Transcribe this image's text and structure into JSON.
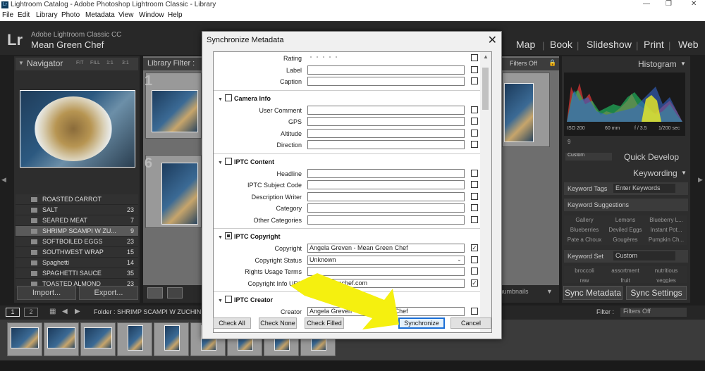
{
  "titlebar": {
    "app_icon": "Lr",
    "title": "Lightroom Catalog - Adobe Photoshop Lightroom Classic - Library",
    "minimize": "—",
    "maximize": "❐",
    "close": "✕"
  },
  "menu": [
    "File",
    "Edit",
    "Library",
    "Photo",
    "Metadata",
    "View",
    "Window",
    "Help"
  ],
  "identity": {
    "logo": "Lr",
    "app_name": "Adobe Lightroom Classic CC",
    "catalog_name": "Mean Green Chef"
  },
  "modules": [
    "Map",
    "Book",
    "Slideshow",
    "Print",
    "Web"
  ],
  "navigator": {
    "title": "Navigator",
    "zoom": [
      "FIT",
      "FILL",
      "1:1",
      "3:1"
    ]
  },
  "folders": [
    {
      "name": "ROASTED CARROT",
      "count": ""
    },
    {
      "name": "SALT",
      "count": "23"
    },
    {
      "name": "SEARED MEAT",
      "count": "7"
    },
    {
      "name": "SHRIMP SCAMPI W ZU...",
      "count": "9",
      "selected": true
    },
    {
      "name": "SOFTBOILED EGGS",
      "count": "23"
    },
    {
      "name": "SOUTHWEST WRAP",
      "count": "15"
    },
    {
      "name": "Spaghetti",
      "count": "14"
    },
    {
      "name": "SPAGHETTI SAUCE",
      "count": "35"
    },
    {
      "name": "TOASTED ALMOND",
      "count": "23"
    }
  ],
  "left_buttons": {
    "import": "Import...",
    "export": "Export..."
  },
  "library_filter": {
    "label": "Library Filter :",
    "filters_off": "Filters Off"
  },
  "grid_numbers": [
    "1",
    "6"
  ],
  "toolbar": {
    "thumbnails": "Thumbnails"
  },
  "histogram": {
    "title": "Histogram",
    "iso": "ISO 200",
    "focal": "60 mm",
    "aperture": "f / 3.5",
    "shutter": "1/200 sec",
    "count": "9"
  },
  "quick_develop": {
    "preset": "Custom",
    "title": "Quick Develop"
  },
  "keywording": {
    "title": "Keywording",
    "tags_label": "Keyword Tags",
    "tags_value": "Enter Keywords",
    "suggestions_title": "Keyword Suggestions",
    "suggestions": [
      "Gallery",
      "Lemons",
      "Blueberry L...",
      "Blueberries",
      "Deviled Eggs",
      "Instant Pot...",
      "Pate a Choux",
      "Gougères",
      "Pumpkin Ch..."
    ],
    "set_label": "Keyword Set",
    "set_value": "Custom",
    "set_items": [
      "broccoli",
      "assortment",
      "nutritious",
      "raw",
      "fruit",
      "veggies"
    ]
  },
  "right_buttons": {
    "sync_metadata": "Sync Metadata",
    "sync_settings": "Sync Settings"
  },
  "filmbar": {
    "page1": "1",
    "page2": "2",
    "folder_label": "Folder : SHRIMP SCAMPI W ZUCHINNI",
    "filter_label": "Filter :",
    "filter_value": "Filters Off"
  },
  "dialog": {
    "title": "Synchronize Metadata",
    "close": "✕",
    "rows_top": [
      {
        "label": "Rating",
        "value": "",
        "checked": false
      },
      {
        "label": "Label",
        "value": "",
        "checked": false
      },
      {
        "label": "Caption",
        "value": "",
        "checked": false
      }
    ],
    "sections": [
      {
        "title": "Camera Info",
        "rows": [
          {
            "label": "User Comment",
            "value": "",
            "checked": false
          },
          {
            "label": "GPS",
            "value": "",
            "checked": false
          },
          {
            "label": "Altitude",
            "value": "",
            "checked": false
          },
          {
            "label": "Direction",
            "value": "",
            "checked": false
          }
        ]
      },
      {
        "title": "IPTC Content",
        "rows": [
          {
            "label": "Headline",
            "value": "",
            "checked": false
          },
          {
            "label": "IPTC Subject Code",
            "value": "",
            "checked": false
          },
          {
            "label": "Description Writer",
            "value": "",
            "checked": false
          },
          {
            "label": "Category",
            "value": "",
            "checked": false
          },
          {
            "label": "Other Categories",
            "value": "",
            "checked": false
          }
        ]
      },
      {
        "title": "IPTC Copyright",
        "rows": [
          {
            "label": "Copyright",
            "value": "Angela Greven - Mean Green Chef",
            "checked": true
          },
          {
            "label": "Copyright Status",
            "value": "Unknown",
            "checked": false
          },
          {
            "label": "Rights Usage Terms",
            "value": "",
            "checked": false
          },
          {
            "label": "Copyright Info URL",
            "value": "meangreenchef.com",
            "checked": true
          }
        ]
      },
      {
        "title": "IPTC Creator",
        "rows": [
          {
            "label": "Creator",
            "value": "Angela Greven - Mean Green Chef",
            "checked": false
          }
        ]
      }
    ],
    "buttons": {
      "check_all": "Check All",
      "check_none": "Check None",
      "check_filled": "Check Filled",
      "synchronize": "Synchronize",
      "cancel": "Cancel"
    },
    "check_mark": "✓"
  },
  "colors": {
    "arrow": "#f5f00f",
    "accent": "#1b6fd6"
  }
}
